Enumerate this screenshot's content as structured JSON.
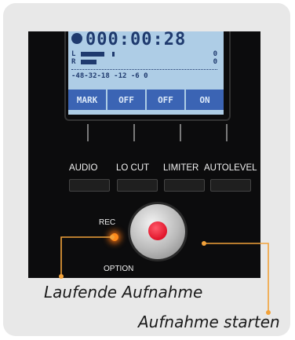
{
  "display": {
    "time": "000:00:28",
    "channel_left": "L",
    "channel_right": "R",
    "zero_left": "0",
    "zero_right": "0",
    "scale": "-48-32-18   -12   -6    0",
    "softkeys": [
      "MARK",
      "OFF",
      "OFF",
      "ON"
    ]
  },
  "buttons": {
    "audio": "AUDIO",
    "locut": "LO CUT",
    "limiter": "LIMITER",
    "autolevel": "AUTOLEVEL"
  },
  "rec_label": "REC",
  "option_label": "OPTION",
  "captions": {
    "rec_indicator": "Laufende Aufnahme",
    "record_button": "Aufnahme starten"
  },
  "colors": {
    "annotation": "#f2a23a",
    "lcd": "#aecde6",
    "softkey": "#3b64b4",
    "rec_led": "#ff8a1a",
    "record_button": "#e0142a"
  }
}
